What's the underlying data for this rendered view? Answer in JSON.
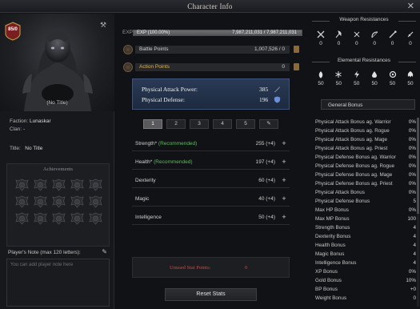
{
  "window": {
    "title": "Character Info"
  },
  "left": {
    "level": "85/0",
    "title_text": "(No Title)",
    "faction_label": "Faction",
    "faction_value": "Lunaskar",
    "clan_label": "Clan",
    "clan_value": "-",
    "title_label": "Title",
    "title_value": "No Title",
    "achievements_header": "Achievements",
    "note_label": "Player's Note  (max 120 letters):",
    "note_placeholder": "You can add player note here"
  },
  "center": {
    "exp_label": "EXP",
    "exp_percent_text": "EXP (100.00%)",
    "exp_fraction": 1.0,
    "exp_values": "7,987,211,031 / 7,987,211,031",
    "battle_points_label": "Battle Points",
    "battle_points_value": "1,007,526 / 0",
    "action_points_label": "Action Points",
    "action_points_value": "0",
    "physical_attack_label": "Physical Attack Power:",
    "physical_attack_value": "385",
    "physical_defense_label": "Physical Defense:",
    "physical_defense_value": "196",
    "tabs": [
      "1",
      "2",
      "3",
      "4",
      "5"
    ],
    "stats": [
      {
        "name": "Strength*",
        "rec": "(Recommended)",
        "value": "255 (+4)"
      },
      {
        "name": "Health*",
        "rec": "(Recommended)",
        "value": "197 (+4)"
      },
      {
        "name": "Dexterity",
        "rec": "",
        "value": "60 (+4)"
      },
      {
        "name": "Magic",
        "rec": "",
        "value": "40 (+4)"
      },
      {
        "name": "Intelligence",
        "rec": "",
        "value": "50 (+4)"
      }
    ],
    "unused_label": "Unused Stat Points:",
    "unused_value": "0",
    "reset_label": "Reset Stats"
  },
  "right": {
    "weapon_header": "Weapon Resistances",
    "weapon_res": [
      {
        "icon": "crossed-swords-icon",
        "value": "0"
      },
      {
        "icon": "axe-icon",
        "value": "0"
      },
      {
        "icon": "crossed-daggers-icon",
        "value": "0"
      },
      {
        "icon": "bow-icon",
        "value": "0"
      },
      {
        "icon": "staff-icon",
        "value": "0"
      },
      {
        "icon": "dagger-icon",
        "value": "0"
      }
    ],
    "elemental_header": "Elemental Resistances",
    "elemental_res": [
      {
        "icon": "fire-icon",
        "value": "50"
      },
      {
        "icon": "frost-icon",
        "value": "50"
      },
      {
        "icon": "lightning-icon",
        "value": "50"
      },
      {
        "icon": "poison-icon",
        "value": "50"
      },
      {
        "icon": "holy-icon",
        "value": "50"
      },
      {
        "icon": "shadow-icon",
        "value": "50"
      }
    ],
    "dropdown_selected": "General Bonus",
    "bonuses": [
      {
        "k": "Physical Attack Bonus ag. Warrior",
        "v": "0%"
      },
      {
        "k": "Physical Attack Bonus ag. Rogue",
        "v": "0%"
      },
      {
        "k": "Physical Attack Bonus ag. Mage",
        "v": "0%"
      },
      {
        "k": "Physical Attack Bonus ag. Priest",
        "v": "0%"
      },
      {
        "k": "Physical Defense Bonus ag. Warrior",
        "v": "0%"
      },
      {
        "k": "Physical Defense Bonus ag. Rogue",
        "v": "0%"
      },
      {
        "k": "Physical Defense Bonus ag. Mage",
        "v": "0%"
      },
      {
        "k": "Physical Defense Bonus ag. Priest",
        "v": "0%"
      },
      {
        "k": "Physical Attack Bonus",
        "v": "0%"
      },
      {
        "k": "Physical Defense Bonus",
        "v": "5"
      },
      {
        "k": "Max HP Bonus",
        "v": "0%"
      },
      {
        "k": "Max MP Bonus",
        "v": "100"
      },
      {
        "k": "Strength Bonus",
        "v": "4"
      },
      {
        "k": "Dexterity Bonus",
        "v": "4"
      },
      {
        "k": "Health Bonus",
        "v": "4"
      },
      {
        "k": "Magic Bonus",
        "v": "4"
      },
      {
        "k": "Intelligence Bonus",
        "v": "4"
      },
      {
        "k": "XP Bonus",
        "v": "0%"
      },
      {
        "k": "Gold Bonus",
        "v": "10%"
      },
      {
        "k": "BP Bonus",
        "v": "+0"
      },
      {
        "k": "Weight Bonus",
        "v": "0"
      }
    ]
  },
  "colors": {
    "recommended": "#5bbf5b",
    "unused_text": "#d64545",
    "combat_panel": "#2a3a55"
  }
}
